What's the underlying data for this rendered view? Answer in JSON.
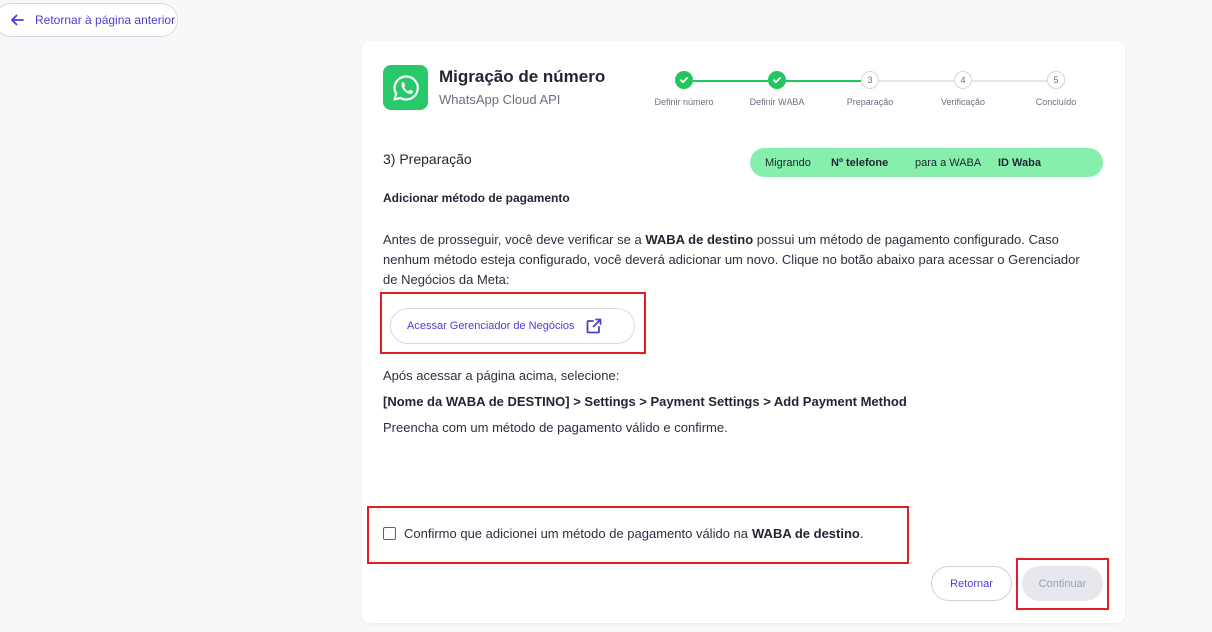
{
  "back_button": {
    "label": "Retornar à página anterior",
    "icon": "arrow-left-icon"
  },
  "header": {
    "title": "Migração de número",
    "subtitle": "WhatsApp Cloud API",
    "logo_icon": "whatsapp-logo-icon"
  },
  "stepper": {
    "steps": [
      {
        "label": "Definir número",
        "number": "1",
        "status": "done"
      },
      {
        "label": "Definir WABA",
        "number": "2",
        "status": "done"
      },
      {
        "label": "Preparação",
        "number": "3",
        "status": "current"
      },
      {
        "label": "Verificação",
        "number": "4",
        "status": "todo"
      },
      {
        "label": "Concluído",
        "number": "5",
        "status": "todo"
      }
    ]
  },
  "section": {
    "title": "3) Preparação"
  },
  "migration_banner": {
    "prefix": "Migrando",
    "phone": "Nº telefone",
    "middle": "para a WABA",
    "waba": "ID Waba"
  },
  "payment": {
    "heading": "Adicionar método de pagamento",
    "para_1": "Antes de prosseguir, você deve verificar se a ",
    "para_bold": "WABA de destino",
    "para_2": " possui um método de pagamento configurado. Caso nenhum método esteja configurado, você deverá adicionar um novo. Clique no botão abaixo para acessar o Gerenciador de Negócios da Meta:",
    "manager_button": "Acessar Gerenciador de Negócios",
    "manager_icon": "external-link-icon",
    "after_access": "Após acessar a página acima, selecione:",
    "path": "[Nome da WABA de DESTINO] > Settings > Payment Settings > Add Payment Method",
    "fill_text": "Preencha com um método de pagamento válido e confirme."
  },
  "confirm": {
    "text": "Confirmo que adicionei um método de pagamento válido na",
    "bold": "WABA de destino",
    "suffix": "."
  },
  "footer": {
    "return_label": "Retornar",
    "continue_label": "Continuar"
  },
  "colors": {
    "accent": "#4a3ed8",
    "success": "#22c55e",
    "banner": "#86efac",
    "highlight": "#e11d2a",
    "whatsapp": "#27c96a"
  }
}
